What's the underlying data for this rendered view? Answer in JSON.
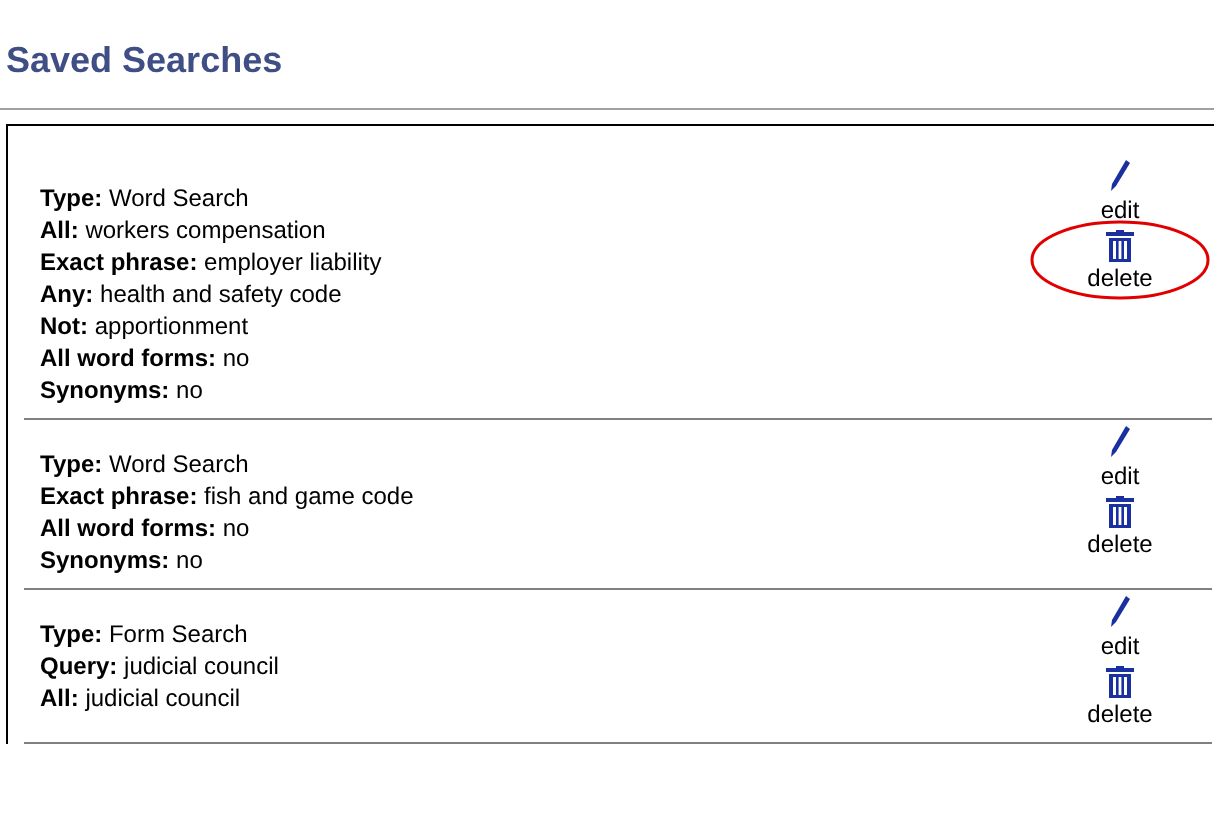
{
  "title": "Saved Searches",
  "searches": [
    {
      "fields": [
        {
          "label": "Type:",
          "value": "Word Search"
        },
        {
          "label": "All:",
          "value": "workers compensation"
        },
        {
          "label": "Exact phrase:",
          "value": "employer liability"
        },
        {
          "label": "Any:",
          "value": "health and safety code"
        },
        {
          "label": "Not:",
          "value": "apportionment"
        },
        {
          "label": "All word forms:",
          "value": "no"
        },
        {
          "label": "Synonyms:",
          "value": "no"
        }
      ],
      "edit": "edit",
      "delete": "delete",
      "delete_circled": true
    },
    {
      "fields": [
        {
          "label": "Type:",
          "value": "Word Search"
        },
        {
          "label": "Exact phrase:",
          "value": "fish and game code"
        },
        {
          "label": "All word forms:",
          "value": "no"
        },
        {
          "label": "Synonyms:",
          "value": "no"
        }
      ],
      "edit": "edit",
      "delete": "delete",
      "delete_circled": false
    },
    {
      "fields": [
        {
          "label": "Type:",
          "value": "Form Search"
        },
        {
          "label": "Query:",
          "value": "judicial council"
        },
        {
          "label": "All:",
          "value": "judicial council"
        }
      ],
      "edit": "edit",
      "delete": "delete",
      "delete_circled": false
    }
  ]
}
